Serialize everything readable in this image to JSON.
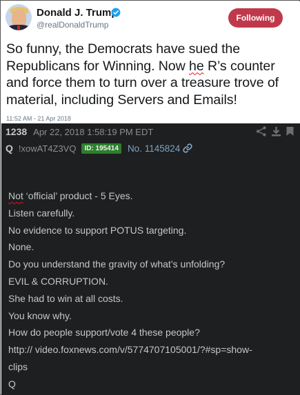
{
  "tweet": {
    "name": "Donald J. Trump",
    "handle": "@realDonaldTrump",
    "follow_label": "Following",
    "text_before": "So funny, the Democrats have sued the Republicans for Winning. Now ",
    "text_misspelled": "he",
    "text_after": " R’s counter and force them to turn over a treasure trove of material, including Servers and Emails!",
    "timestamp": "11:52 AM - 21 Apr 2018",
    "icons": [
      "avatar",
      "verified-badge-icon"
    ]
  },
  "post": {
    "number": "1238",
    "date": "Apr 22, 2018 1:58:19 PM EDT",
    "name": "Q",
    "tripcode": "!xowAT4Z3VQ",
    "id_badge": "ID: 195414",
    "post_no": "No. 1145824",
    "icons": [
      "share-icon",
      "download-icon",
      "bookmark-icon",
      "link-icon"
    ],
    "body": {
      "line1_underlined": "Not",
      "line1_rest": " ‘official’ product - 5 Eyes.",
      "lines": [
        "Listen carefully.",
        "No evidence to support POTUS targeting.",
        "None.",
        "Do you understand the gravity of what’s unfolding?",
        "EVIL & CORRUPTION.",
        "She had to win at all costs.",
        "You know why.",
        "How do people support/vote 4 these people?",
        "http:// video.foxnews.com/v/5774707105001/?#sp=show-",
        "clips",
        "Q"
      ]
    }
  },
  "colors": {
    "follow_button": "#c0394b",
    "post_background": "#1d1f21",
    "post_text": "#c5c8c6",
    "id_badge": "#2d7f2d",
    "post_link": "#81a2be",
    "verified": "#1da1f2"
  }
}
